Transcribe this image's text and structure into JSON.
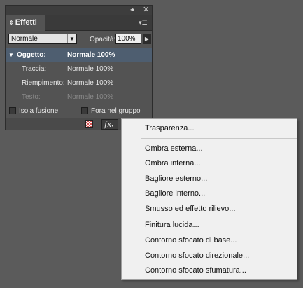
{
  "panel": {
    "tab_label": "Effetti",
    "blend_mode": "Normale",
    "opacity_label": "Opacità:",
    "opacity_value": "100%",
    "rows": [
      {
        "name": "Oggetto:",
        "value": "Normale 100%"
      },
      {
        "name": "Traccia:",
        "value": "Normale 100%"
      },
      {
        "name": "Riempimento:",
        "value": "Normale 100%"
      },
      {
        "name": "Testo:",
        "value": "Normale 100%"
      }
    ],
    "checkboxes": {
      "isolate": "Isola fusione",
      "knockout": "Fora nel gruppo"
    },
    "fx_label": "fx"
  },
  "menu": {
    "items": [
      "Trasparenza...",
      "Ombra esterna...",
      "Ombra interna...",
      "Bagliore esterno...",
      "Bagliore interno...",
      "Smusso ed effetto rilievo...",
      "Finitura lucida...",
      "Contorno sfocato di base...",
      "Contorno sfocato direzionale...",
      "Contorno sfocato sfumatura..."
    ]
  },
  "colors": {
    "workspace": "#5b5b5b",
    "panel": "#535353",
    "selection": "#4e5e70",
    "menu": "#f0f0f0"
  },
  "icons": {
    "collapse": "double-chevron-right-icon",
    "close": "close-icon",
    "panel_menu": "panel-menu-icon",
    "clear_effects": "clear-effects-icon",
    "fx": "fx-icon"
  }
}
